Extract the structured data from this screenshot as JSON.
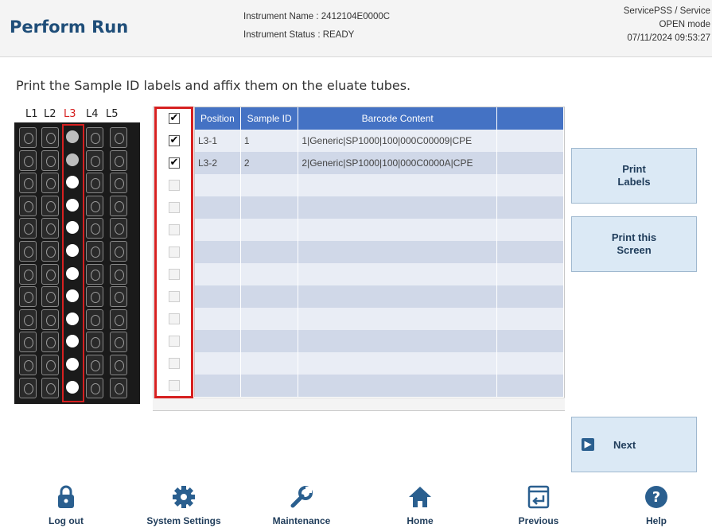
{
  "header": {
    "title": "Perform Run",
    "instrument_name": "Instrument Name : 2412104E0000C",
    "instrument_status": "Instrument Status : READY",
    "user": "ServicePSS / Service",
    "mode": "OPEN mode",
    "datetime": "07/11/2024 09:53:27"
  },
  "instruction": "Print the Sample ID labels and affix them on the eluate tubes.",
  "rack": {
    "lanes": [
      "L1",
      "L2",
      "L3",
      "L4",
      "L5"
    ],
    "highlighted_lane": "L3",
    "highlight_color": "#d62020"
  },
  "table": {
    "columns": [
      "Position",
      "Sample ID",
      "Barcode Content"
    ],
    "header_checked": true,
    "rows": [
      {
        "checked": true,
        "position": "L3-1",
        "sample_id": "1",
        "barcode": "1|Generic|SP1000|100|000C00009|CPE"
      },
      {
        "checked": true,
        "position": "L3-2",
        "sample_id": "2",
        "barcode": "2|Generic|SP1000|100|000C0000A|CPE"
      }
    ],
    "empty_rows": 10
  },
  "buttons": {
    "print_labels": "Print\nLabels",
    "print_screen": "Print this\nScreen",
    "next": "Next"
  },
  "toolbar": {
    "logout": "Log out",
    "system_settings": "System Settings",
    "maintenance": "Maintenance",
    "home": "Home",
    "previous": "Previous",
    "help": "Help"
  },
  "colors": {
    "accent": "#1f4e79",
    "table_header": "#4472c4",
    "button_bg": "#dbe9f5"
  }
}
